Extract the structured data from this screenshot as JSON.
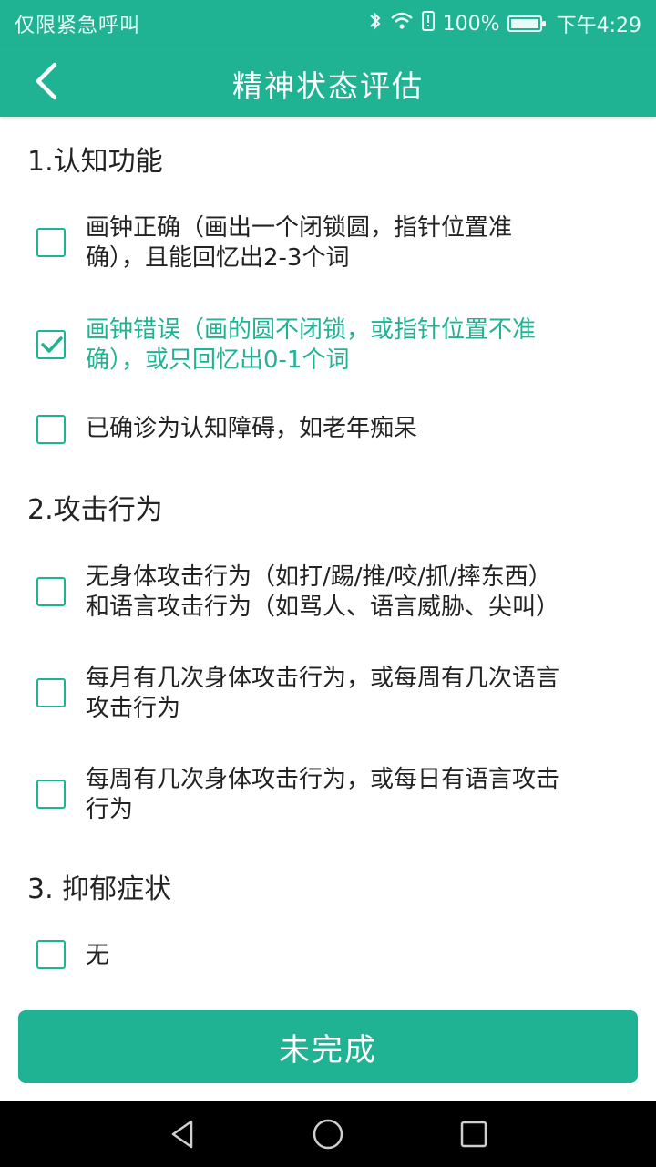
{
  "status_bar": {
    "left_text": "仅限紧急呼叫",
    "battery": "100%",
    "time": "下午4:29"
  },
  "app_bar": {
    "title": "精神状态评估"
  },
  "sections": [
    {
      "title": "1.认知功能",
      "options": [
        {
          "line1": "画钟正确（画出一个闭锁圆，指针位置准",
          "line2": "确），且能回忆出2-3个词",
          "checked": false
        },
        {
          "line1": "画钟错误（画的圆不闭锁，或指针位置不准",
          "line2": "确），或只回忆出0-1个词",
          "checked": true
        },
        {
          "line1": "已确诊为认知障碍，如老年痴呆",
          "line2": "",
          "checked": false
        }
      ]
    },
    {
      "title": "2.攻击行为",
      "options": [
        {
          "line1": "无身体攻击行为（如打/踢/推/咬/抓/摔东西）",
          "line2": "和语言攻击行为（如骂人、语言威胁、尖叫）",
          "checked": false
        },
        {
          "line1": "每月有几次身体攻击行为，或每周有几次语言",
          "line2": "攻击行为",
          "checked": false
        },
        {
          "line1": "每周有几次身体攻击行为，或每日有语言攻击",
          "line2": "行为",
          "checked": false
        }
      ]
    },
    {
      "title": "3. 抑郁症状",
      "options": [
        {
          "line1": "无",
          "line2": "",
          "checked": false
        }
      ]
    }
  ],
  "submit_button": "未完成",
  "colors": {
    "accent": "#1fb394",
    "text": "#222222",
    "nav_bg": "#000000"
  },
  "icons": {
    "back": "chevron-left-icon",
    "bluetooth": "bluetooth-icon",
    "wifi": "wifi-icon",
    "battery": "battery-icon",
    "check": "check-icon",
    "nav_back": "triangle-back-icon",
    "nav_home": "circle-home-icon",
    "nav_recents": "square-recents-icon"
  }
}
